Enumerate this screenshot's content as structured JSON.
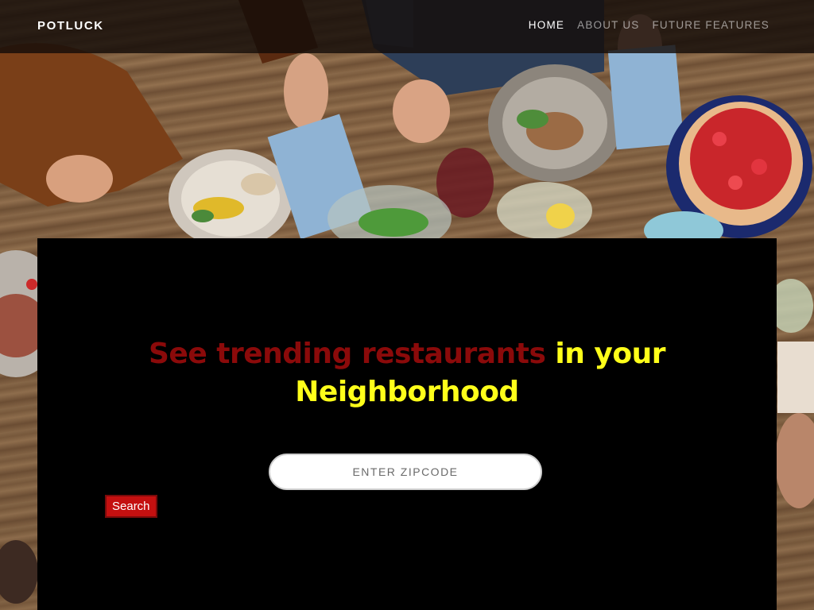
{
  "brand": "POTLUCK",
  "nav": {
    "items": [
      {
        "label": "HOME",
        "active": true
      },
      {
        "label": "ABOUT US",
        "active": false
      },
      {
        "label": "FUTURE FEATURES",
        "active": false
      }
    ]
  },
  "hero": {
    "headline_part1": "See trending restaurants",
    "headline_part2": "in your",
    "headline_part3": "Neighborhood"
  },
  "search": {
    "placeholder": "ENTER ZIPCODE",
    "value": "",
    "button_label": "Search"
  },
  "colors": {
    "headline_red": "#8b0a0a",
    "headline_yellow": "#ffff1a",
    "button": "#c41010",
    "panel": "#000000"
  }
}
